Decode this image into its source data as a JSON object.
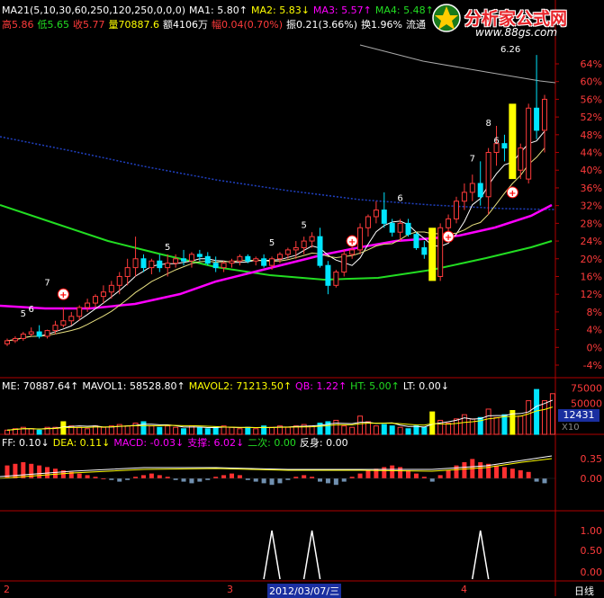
{
  "colors": {
    "up": "#ff3b3b",
    "down": "#00e5ff",
    "frame": "#b00000",
    "yellow": "#ffff00",
    "magenta": "#ff00ff",
    "green": "#22dd22",
    "white": "#ffffff",
    "grey": "#bbbbbb"
  },
  "header1": [
    {
      "text": "MA21(5,10,30,60,250,120,250,0,0,0)",
      "color": "#ffffff"
    },
    {
      "text": "MA1: 5.80",
      "color": "#ffffff",
      "arrow": "↑"
    },
    {
      "text": "MA2: 5.83",
      "color": "#ffff00",
      "arrow": "↓"
    },
    {
      "text": "MA3: 5.57",
      "color": "#ff00ff",
      "arrow": "↑"
    },
    {
      "text": "MA4: 5.48",
      "color": "#22dd22",
      "arrow": "↑"
    }
  ],
  "header2": [
    {
      "text": "高5.86",
      "color": "#ff3b3b"
    },
    {
      "text": "低5.65",
      "color": "#22dd22"
    },
    {
      "text": "收5.77",
      "color": "#ff3b3b"
    },
    {
      "text": "量70887.6",
      "color": "#ffff00"
    },
    {
      "text": "额4106万",
      "color": "#ffffff"
    },
    {
      "text": "幅0.04(0.70%)",
      "color": "#ff3b3b"
    },
    {
      "text": "振0.21(3.66%)",
      "color": "#ffffff"
    },
    {
      "text": "换1.96%",
      "color": "#ffffff"
    },
    {
      "text": "流通",
      "color": "#ffffff"
    }
  ],
  "watermark": {
    "title": "分析家公式网",
    "url": "www.88gs.com"
  },
  "vol_header": [
    {
      "text": "ME: 70887.64",
      "color": "#ffffff",
      "arrow": "↑"
    },
    {
      "text": "MAVOL1: 58528.80",
      "color": "#ffffff",
      "arrow": "↑"
    },
    {
      "text": "MAVOL2: 71213.50",
      "color": "#ffff00",
      "arrow": "↑"
    },
    {
      "text": "QB: 1.22",
      "color": "#ff00ff",
      "arrow": "↑"
    },
    {
      "text": "HT: 5.00",
      "color": "#22dd22",
      "arrow": "↑"
    },
    {
      "text": "LT: 0.00",
      "color": "#ffffff",
      "arrow": "↓"
    }
  ],
  "macd_header": [
    {
      "text": "FF: 0.10",
      "color": "#ffffff",
      "arrow": "↓"
    },
    {
      "text": "DEA: 0.11",
      "color": "#ffff00",
      "arrow": "↓"
    },
    {
      "text": "MACD: -0.03",
      "color": "#ff00ff",
      "arrow": "↓"
    },
    {
      "text": "支撑: 6.02",
      "color": "#ff00ff",
      "arrow": "↓"
    },
    {
      "text": "二次: 0.00",
      "color": "#22dd22"
    },
    {
      "text": "反身: 0.00",
      "color": "#ffffff"
    }
  ],
  "price_axis": [
    "64%",
    "60%",
    "56%",
    "52%",
    "48%",
    "44%",
    "40%",
    "36%",
    "32%",
    "28%",
    "24%",
    "20%",
    "16%",
    "12%",
    "8%",
    "4%",
    "0%",
    "-4%"
  ],
  "vol_axis": [
    "75000",
    "50000"
  ],
  "vol_badge": "12431",
  "vol_unit": "X10",
  "macd_axis": [
    "0.35",
    "0.00"
  ],
  "sig_axis": [
    "1.00",
    "0.50",
    "0.00"
  ],
  "bottom_labels": {
    "a": "2",
    "b": "3",
    "date": "2012/03/07/三",
    "c": "4",
    "period": "日线"
  },
  "count_labels": [
    "5",
    "6",
    "7",
    "5",
    "5",
    "5",
    "6",
    "7",
    "8",
    "6"
  ],
  "top_value": "6.26",
  "chart_data": [
    {
      "type": "candlestick",
      "title": "",
      "ylabel": "",
      "yaxis_ticks": [
        "64%",
        "60%",
        "56%",
        "52%",
        "48%",
        "44%",
        "40%",
        "36%",
        "32%",
        "28%",
        "24%",
        "20%",
        "16%",
        "12%",
        "8%",
        "4%",
        "0%",
        "-4%"
      ],
      "candles": [
        {
          "o": 0.8,
          "h": 2.0,
          "l": 0.3,
          "c": 1.5
        },
        {
          "o": 1.5,
          "h": 2.5,
          "l": 1.0,
          "c": 2.0
        },
        {
          "o": 2.0,
          "h": 3.5,
          "l": 1.5,
          "c": 3.0
        },
        {
          "o": 3.0,
          "h": 4.5,
          "l": 2.5,
          "c": 3.5
        },
        {
          "o": 3.5,
          "h": 5.0,
          "l": 2.0,
          "c": 2.5
        },
        {
          "o": 2.5,
          "h": 4.0,
          "l": 2.0,
          "c": 3.8
        },
        {
          "o": 3.8,
          "h": 6.0,
          "l": 3.0,
          "c": 5.0
        },
        {
          "o": 5.0,
          "h": 9.0,
          "l": 4.5,
          "c": 6.0
        },
        {
          "o": 6.0,
          "h": 8.0,
          "l": 5.0,
          "c": 7.0
        },
        {
          "o": 7.0,
          "h": 9.5,
          "l": 6.0,
          "c": 9.0
        },
        {
          "o": 9.0,
          "h": 11.0,
          "l": 8.0,
          "c": 10.0
        },
        {
          "o": 10.0,
          "h": 12.0,
          "l": 9.0,
          "c": 11.5
        },
        {
          "o": 11.5,
          "h": 14.0,
          "l": 10.0,
          "c": 12.5
        },
        {
          "o": 12.5,
          "h": 15.0,
          "l": 11.0,
          "c": 14.0
        },
        {
          "o": 14.0,
          "h": 17.0,
          "l": 12.0,
          "c": 16.0
        },
        {
          "o": 16.0,
          "h": 20.0,
          "l": 14.0,
          "c": 18.0
        },
        {
          "o": 18.0,
          "h": 25.0,
          "l": 16.0,
          "c": 20.0
        },
        {
          "o": 20.0,
          "h": 21.0,
          "l": 17.0,
          "c": 18.0
        },
        {
          "o": 18.0,
          "h": 20.0,
          "l": 16.5,
          "c": 19.5
        },
        {
          "o": 19.5,
          "h": 21.0,
          "l": 17.0,
          "c": 18.0
        },
        {
          "o": 18.0,
          "h": 21.0,
          "l": 16.0,
          "c": 19.0
        },
        {
          "o": 19.0,
          "h": 21.0,
          "l": 18.0,
          "c": 20.0
        },
        {
          "o": 20.0,
          "h": 22.0,
          "l": 18.5,
          "c": 19.5
        },
        {
          "o": 19.5,
          "h": 21.5,
          "l": 18.0,
          "c": 21.0
        },
        {
          "o": 21.0,
          "h": 22.0,
          "l": 19.5,
          "c": 20.5
        },
        {
          "o": 20.5,
          "h": 21.5,
          "l": 18.5,
          "c": 19.0
        },
        {
          "o": 19.0,
          "h": 20.5,
          "l": 17.0,
          "c": 18.0
        },
        {
          "o": 18.0,
          "h": 19.5,
          "l": 17.0,
          "c": 19.0
        },
        {
          "o": 19.0,
          "h": 20.0,
          "l": 18.0,
          "c": 19.5
        },
        {
          "o": 19.5,
          "h": 21.0,
          "l": 18.5,
          "c": 20.5
        },
        {
          "o": 20.5,
          "h": 21.0,
          "l": 19.0,
          "c": 19.5
        },
        {
          "o": 19.5,
          "h": 20.5,
          "l": 18.5,
          "c": 20.0
        },
        {
          "o": 20.0,
          "h": 21.0,
          "l": 18.0,
          "c": 18.5
        },
        {
          "o": 18.5,
          "h": 20.5,
          "l": 17.5,
          "c": 20.0
        },
        {
          "o": 20.0,
          "h": 21.5,
          "l": 19.0,
          "c": 21.0
        },
        {
          "o": 21.0,
          "h": 22.5,
          "l": 20.0,
          "c": 22.0
        },
        {
          "o": 22.0,
          "h": 24.0,
          "l": 20.0,
          "c": 22.5
        },
        {
          "o": 22.5,
          "h": 25.0,
          "l": 21.0,
          "c": 24.0
        },
        {
          "o": 24.0,
          "h": 26.0,
          "l": 22.5,
          "c": 25.0
        },
        {
          "o": 25.0,
          "h": 27.0,
          "l": 18.0,
          "c": 18.5
        },
        {
          "o": 18.5,
          "h": 19.5,
          "l": 12.0,
          "c": 14.0
        },
        {
          "o": 14.0,
          "h": 17.5,
          "l": 13.5,
          "c": 17.0
        },
        {
          "o": 17.0,
          "h": 22.0,
          "l": 16.0,
          "c": 21.0
        },
        {
          "o": 21.0,
          "h": 24.0,
          "l": 20.0,
          "c": 22.0
        },
        {
          "o": 22.0,
          "h": 28.0,
          "l": 21.0,
          "c": 27.0
        },
        {
          "o": 27.0,
          "h": 30.0,
          "l": 25.0,
          "c": 29.5
        },
        {
          "o": 29.5,
          "h": 33.0,
          "l": 28.0,
          "c": 31.0
        },
        {
          "o": 31.0,
          "h": 35.0,
          "l": 27.0,
          "c": 28.0
        },
        {
          "o": 28.0,
          "h": 29.0,
          "l": 25.0,
          "c": 26.0
        },
        {
          "o": 26.0,
          "h": 29.0,
          "l": 24.0,
          "c": 28.0
        },
        {
          "o": 28.0,
          "h": 29.0,
          "l": 25.0,
          "c": 25.5
        },
        {
          "o": 25.5,
          "h": 26.0,
          "l": 22.0,
          "c": 22.5
        },
        {
          "o": 22.5,
          "h": 24.0,
          "l": 20.0,
          "c": 21.0
        },
        {
          "o": 21.0,
          "h": 22.0,
          "l": 17.0,
          "c": 18.0
        },
        {
          "o": 16.0,
          "h": 28.0,
          "l": 15.0,
          "c": 27.0
        },
        {
          "o": 27.0,
          "h": 30.0,
          "l": 26.0,
          "c": 29.0
        },
        {
          "o": 29.0,
          "h": 34.0,
          "l": 28.0,
          "c": 33.0
        },
        {
          "o": 33.0,
          "h": 37.0,
          "l": 31.0,
          "c": 35.0
        },
        {
          "o": 35.0,
          "h": 39.0,
          "l": 33.0,
          "c": 37.0
        },
        {
          "o": 37.0,
          "h": 42.0,
          "l": 32.0,
          "c": 34.0
        },
        {
          "o": 34.0,
          "h": 45.0,
          "l": 30.0,
          "c": 44.0
        },
        {
          "o": 44.0,
          "h": 50.0,
          "l": 41.0,
          "c": 46.0
        },
        {
          "o": 46.0,
          "h": 48.0,
          "l": 42.0,
          "c": 45.0
        },
        {
          "o": 45.0,
          "h": 52.0,
          "l": 39.0,
          "c": 40.0
        },
        {
          "o": 40.0,
          "h": 46.0,
          "l": 38.0,
          "c": 45.0
        },
        {
          "o": 38.0,
          "h": 55.0,
          "l": 37.0,
          "c": 54.0
        },
        {
          "o": 54.0,
          "h": 66.0,
          "l": 47.0,
          "c": 49.0
        },
        {
          "o": 49.0,
          "h": 57.0,
          "l": 44.0,
          "c": 56.0
        }
      ]
    },
    {
      "type": "bar",
      "title": "",
      "values": [
        3,
        4,
        5,
        4,
        3,
        5,
        5,
        9,
        6,
        5,
        4,
        6,
        5,
        6,
        7,
        6,
        8,
        9,
        6,
        5,
        6,
        5,
        4,
        6,
        5,
        4,
        5,
        6,
        5,
        4,
        5,
        4,
        6,
        5,
        6,
        5,
        6,
        7,
        6,
        8,
        9,
        10,
        6,
        5,
        13,
        9,
        6,
        7,
        6,
        5,
        4,
        6,
        5,
        16,
        10,
        8,
        11,
        14,
        11,
        12,
        18,
        12,
        14,
        17,
        13,
        24,
        32,
        24,
        29
      ]
    },
    {
      "type": "bar",
      "title": "",
      "values": [
        0.08,
        0.09,
        0.1,
        0.09,
        0.08,
        0.07,
        0.06,
        0.05,
        0.04,
        0.03,
        0.02,
        0.01,
        0.0,
        -0.01,
        -0.02,
        -0.01,
        0.01,
        0.02,
        0.03,
        0.02,
        0.01,
        -0.01,
        -0.02,
        -0.03,
        -0.02,
        -0.01,
        0.01,
        0.02,
        0.03,
        0.02,
        -0.01,
        -0.02,
        -0.03,
        -0.04,
        -0.03,
        -0.01,
        0.01,
        0.02,
        0.01,
        -0.02,
        -0.03,
        -0.04,
        -0.02,
        0.01,
        0.03,
        0.05,
        0.06,
        0.07,
        0.08,
        0.07,
        0.05,
        0.03,
        0.01,
        -0.02,
        0.02,
        0.05,
        0.08,
        0.1,
        0.12,
        0.1,
        0.09,
        0.08,
        0.07,
        0.06,
        0.05,
        0.04,
        -0.02,
        -0.03
      ]
    }
  ]
}
